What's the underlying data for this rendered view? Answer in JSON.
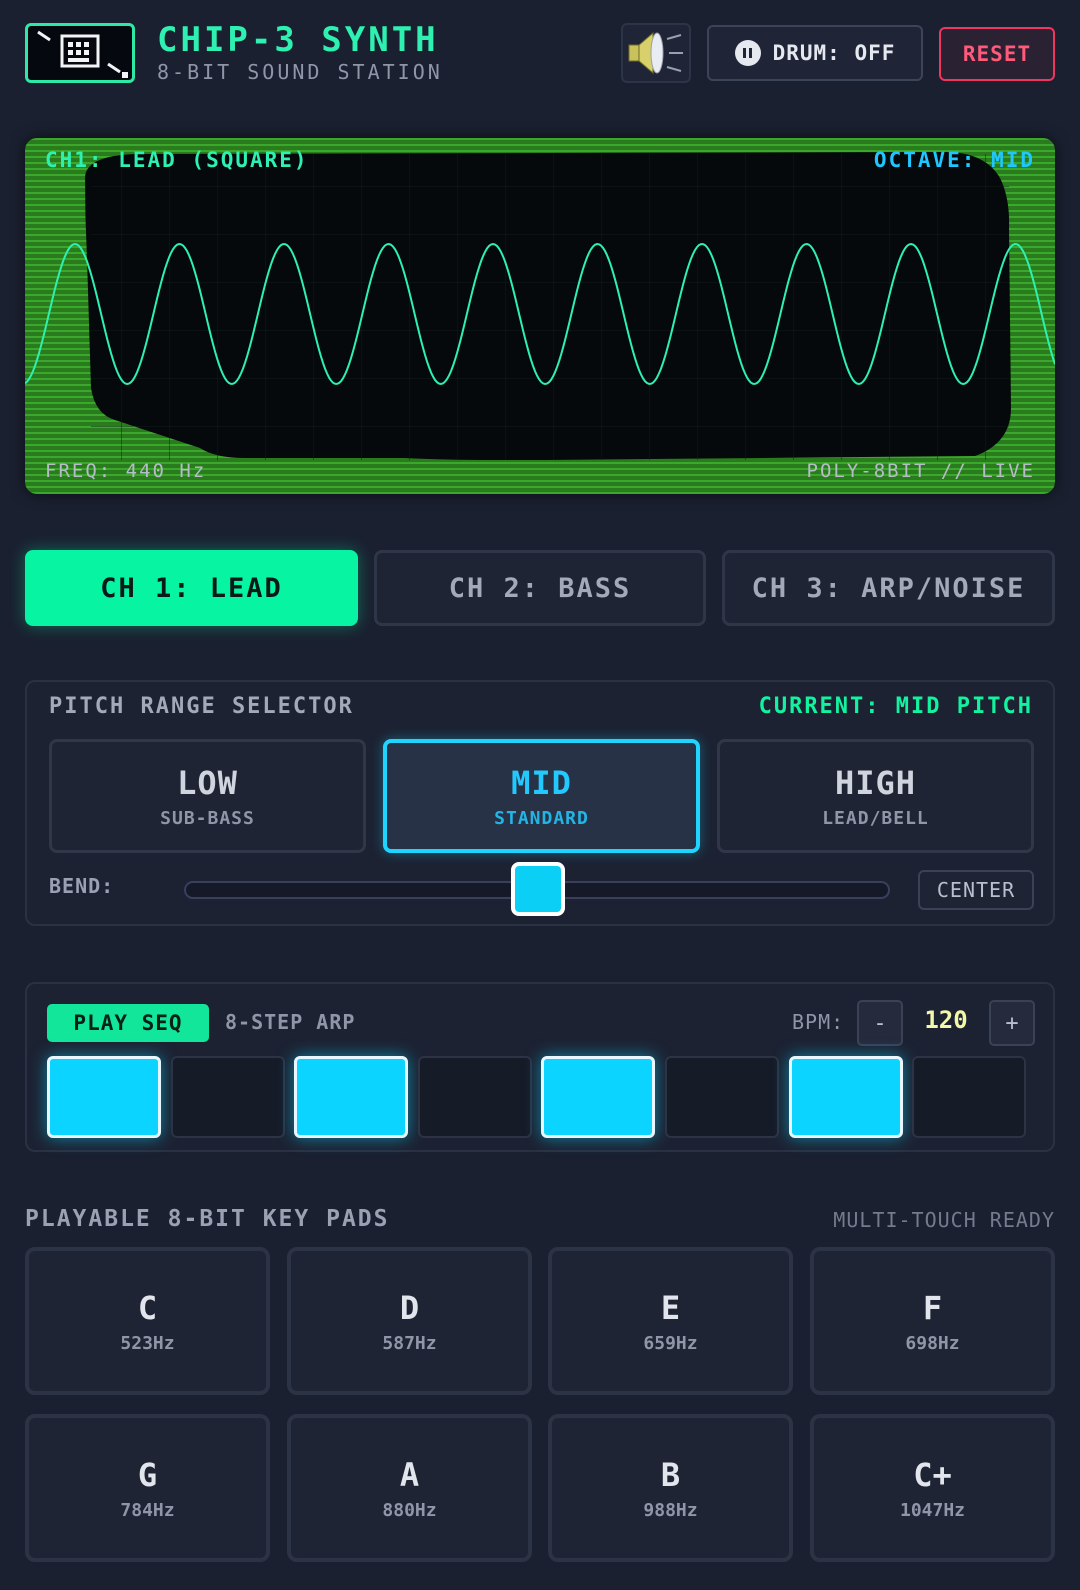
{
  "header": {
    "title": "CHIP-3 SYNTH",
    "subtitle": "8-BIT SOUND STATION",
    "logo_icon": "pixel-computer-icon",
    "speaker_icon": "speaker-volume-icon",
    "drum_label": "DRUM: OFF",
    "drum_icon": "pause-icon",
    "reset_label": "RESET"
  },
  "scope": {
    "channel_label": "CH1: LEAD (SQUARE)",
    "octave_label": "OCTAVE: MID",
    "freq_label": "FREQ: 440 Hz",
    "mode_label": "POLY-8BIT // LIVE",
    "wave_color": "#2ef0b0"
  },
  "tabs": [
    {
      "label": "CH 1: LEAD",
      "active": true
    },
    {
      "label": "CH 2: BASS",
      "active": false
    },
    {
      "label": "CH 3: ARP/NOISE",
      "active": false
    }
  ],
  "pitch": {
    "title": "PITCH RANGE SELECTOR",
    "current": "CURRENT: MID PITCH",
    "ranges": [
      {
        "label": "LOW",
        "sub": "SUB-BASS",
        "active": false
      },
      {
        "label": "MID",
        "sub": "STANDARD",
        "active": true
      },
      {
        "label": "HIGH",
        "sub": "LEAD/BELL",
        "active": false
      }
    ],
    "bend_label": "BEND:",
    "bend_value": 0.5,
    "center_label": "CENTER"
  },
  "sequencer": {
    "play_label": "PLAY SEQ",
    "mode_label": "8-STEP ARP",
    "bpm_label": "BPM:",
    "bpm_minus": "-",
    "bpm_value": "120",
    "bpm_plus": "+",
    "steps": [
      true,
      false,
      true,
      false,
      true,
      false,
      true,
      false
    ]
  },
  "pads": {
    "title": "PLAYABLE 8-BIT KEY PADS",
    "status": "MULTI-TOUCH READY",
    "keys": [
      {
        "note": "C",
        "hz": "523Hz"
      },
      {
        "note": "D",
        "hz": "587Hz"
      },
      {
        "note": "E",
        "hz": "659Hz"
      },
      {
        "note": "F",
        "hz": "698Hz"
      },
      {
        "note": "G",
        "hz": "784Hz"
      },
      {
        "note": "A",
        "hz": "880Hz"
      },
      {
        "note": "B",
        "hz": "988Hz"
      },
      {
        "note": "C+",
        "hz": "1047Hz"
      }
    ]
  },
  "colors": {
    "accent_green": "#07f5a3",
    "accent_cyan": "#0ad4ff",
    "reset_red": "#f0355e",
    "background": "#1a2030"
  }
}
